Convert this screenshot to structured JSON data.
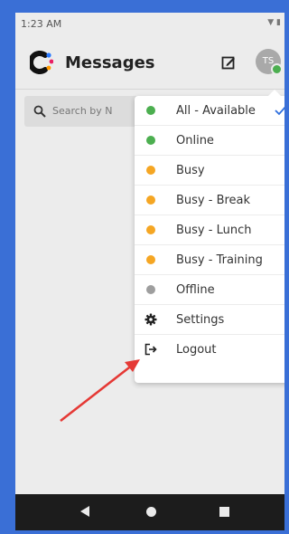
{
  "status_bar": {
    "time": "1:23 AM"
  },
  "header": {
    "title": "Messages",
    "avatar_initials": "TS"
  },
  "search": {
    "placeholder": "Search by N"
  },
  "status_menu": {
    "items": [
      {
        "label": "All - Available",
        "dot_color": "#4caf50",
        "selected": true
      },
      {
        "label": "Online",
        "dot_color": "#4caf50"
      },
      {
        "label": "Busy",
        "dot_color": "#f5a623"
      },
      {
        "label": "Busy - Break",
        "dot_color": "#f5a623"
      },
      {
        "label": "Busy - Lunch",
        "dot_color": "#f5a623"
      },
      {
        "label": "Busy - Training",
        "dot_color": "#f5a623"
      },
      {
        "label": "Offline",
        "dot_color": "#9e9e9e"
      },
      {
        "label": "Settings",
        "icon": "gear-icon"
      },
      {
        "label": "Logout",
        "icon": "logout-icon"
      }
    ]
  },
  "colors": {
    "accent": "#2f6fde",
    "annotation_arrow": "#e53935",
    "frame_border": "#3a6fd6"
  }
}
